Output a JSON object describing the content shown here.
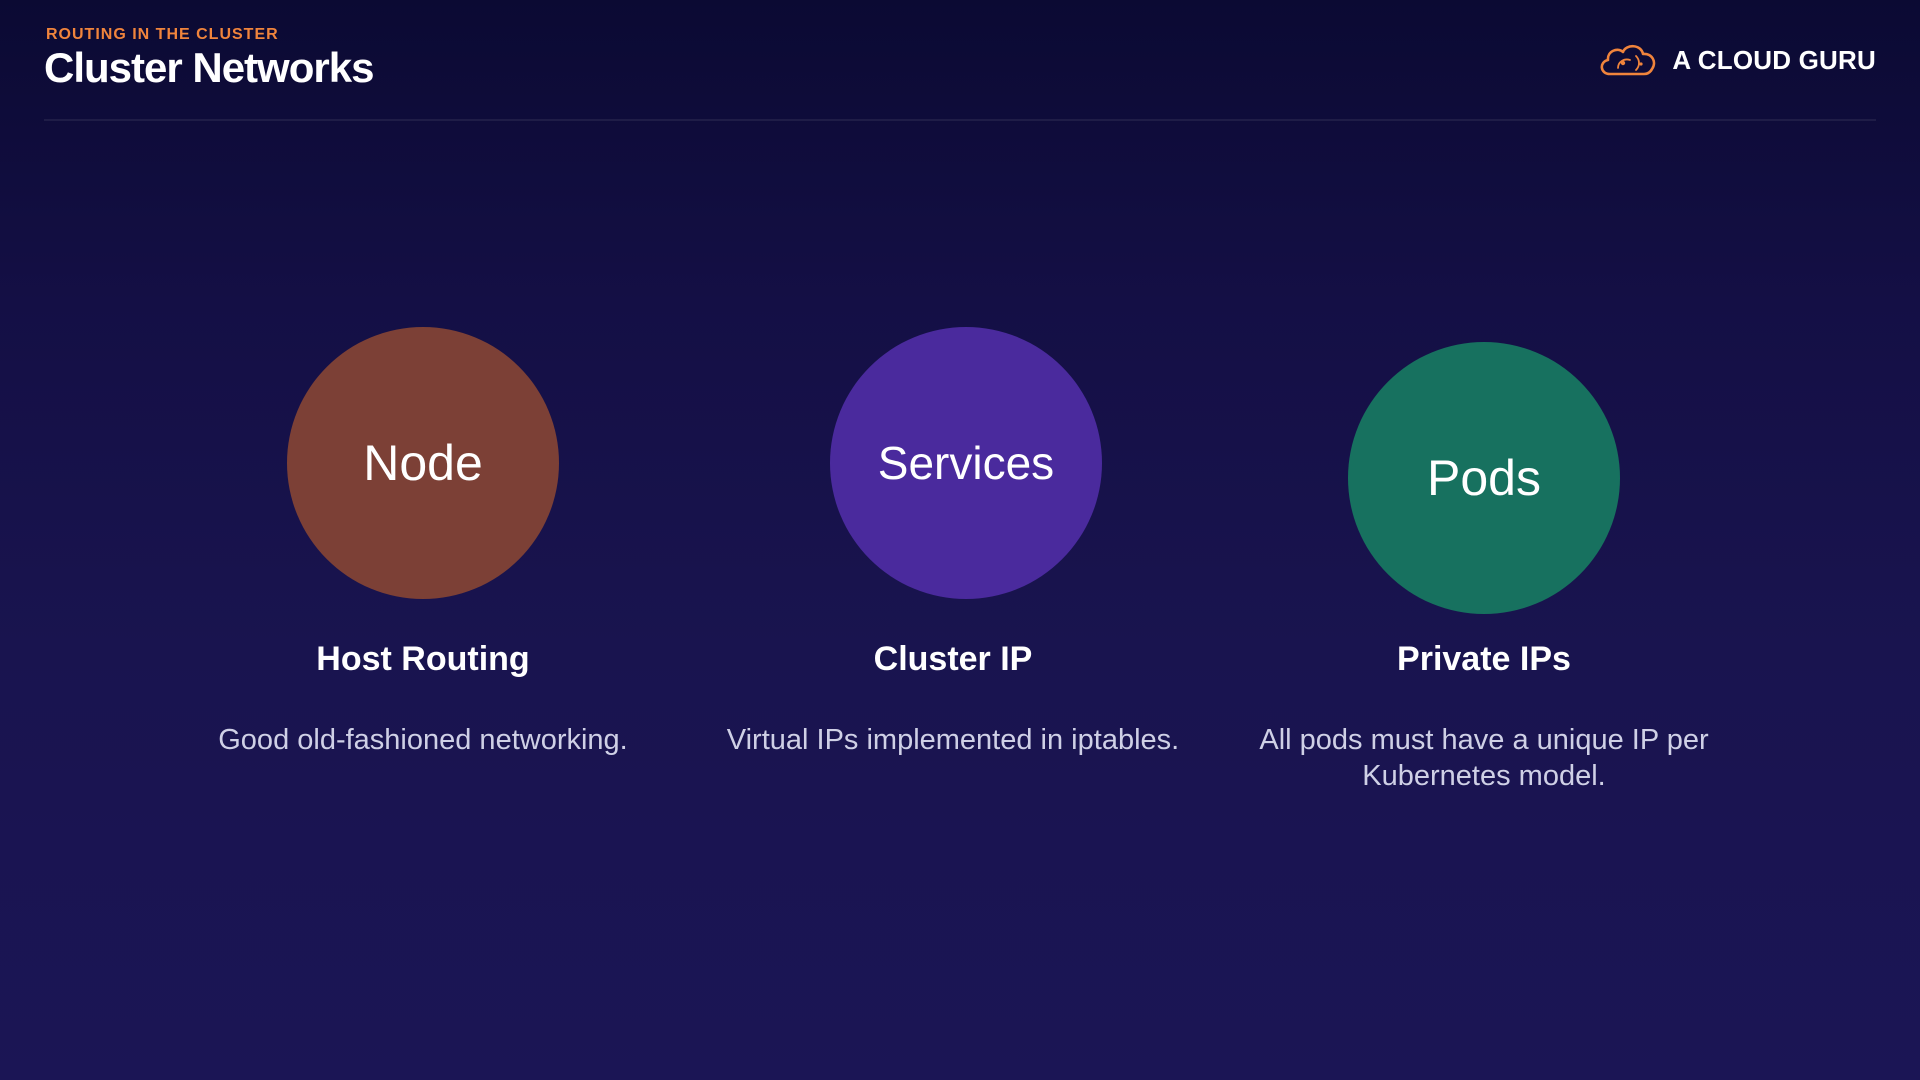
{
  "header": {
    "eyebrow": "ROUTING IN THE CLUSTER",
    "title": "Cluster Networks"
  },
  "brand": {
    "logo_icon": "cloud-guru-icon",
    "name": "A CLOUD GURU",
    "accent_color": "#f0843c"
  },
  "items": [
    {
      "circle_label": "Node",
      "color": "#7c4036",
      "heading": "Host Routing",
      "description": "Good old-fashioned networking."
    },
    {
      "circle_label": "Services",
      "color": "#4a2a9d",
      "heading": "Cluster IP",
      "description": "Virtual IPs implemented in iptables."
    },
    {
      "circle_label": "Pods",
      "color": "#17715f",
      "heading": "Private IPs",
      "description": "All pods must have a unique IP per Kubernetes model."
    }
  ]
}
